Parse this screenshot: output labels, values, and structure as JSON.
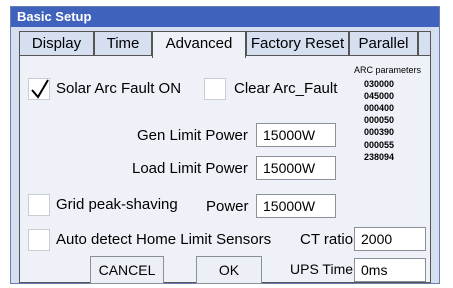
{
  "window": {
    "title": "Basic Setup"
  },
  "tabs": [
    {
      "label": "Display"
    },
    {
      "label": "Time"
    },
    {
      "label": "Advanced"
    },
    {
      "label": "Factory Reset"
    },
    {
      "label": "Parallel"
    }
  ],
  "active_tab": "Advanced",
  "solar_arc_fault": {
    "label": "Solar Arc Fault ON",
    "checked": true
  },
  "clear_arc_fault": {
    "label": "Clear Arc_Fault",
    "checked": false
  },
  "arc_parameters": {
    "title": "ARC parameters",
    "values": [
      "030000",
      "045000",
      "000400",
      "000050",
      "000390",
      "000055",
      "238094"
    ]
  },
  "gen_limit_power": {
    "label": "Gen Limit Power",
    "value": "15000W"
  },
  "load_limit_power": {
    "label": "Load Limit Power",
    "value": "15000W"
  },
  "grid_peak_shaving": {
    "label": "Grid peak-shaving",
    "checked": false
  },
  "power": {
    "label": "Power",
    "value": "15000W"
  },
  "auto_detect": {
    "label": "Auto detect Home Limit Sensors",
    "checked": false
  },
  "ct_ratio": {
    "label": "CT ratio",
    "value": "2000"
  },
  "ups_time": {
    "label": "UPS Time",
    "value": "0ms"
  },
  "buttons": {
    "cancel": "CANCEL",
    "ok": "OK"
  }
}
